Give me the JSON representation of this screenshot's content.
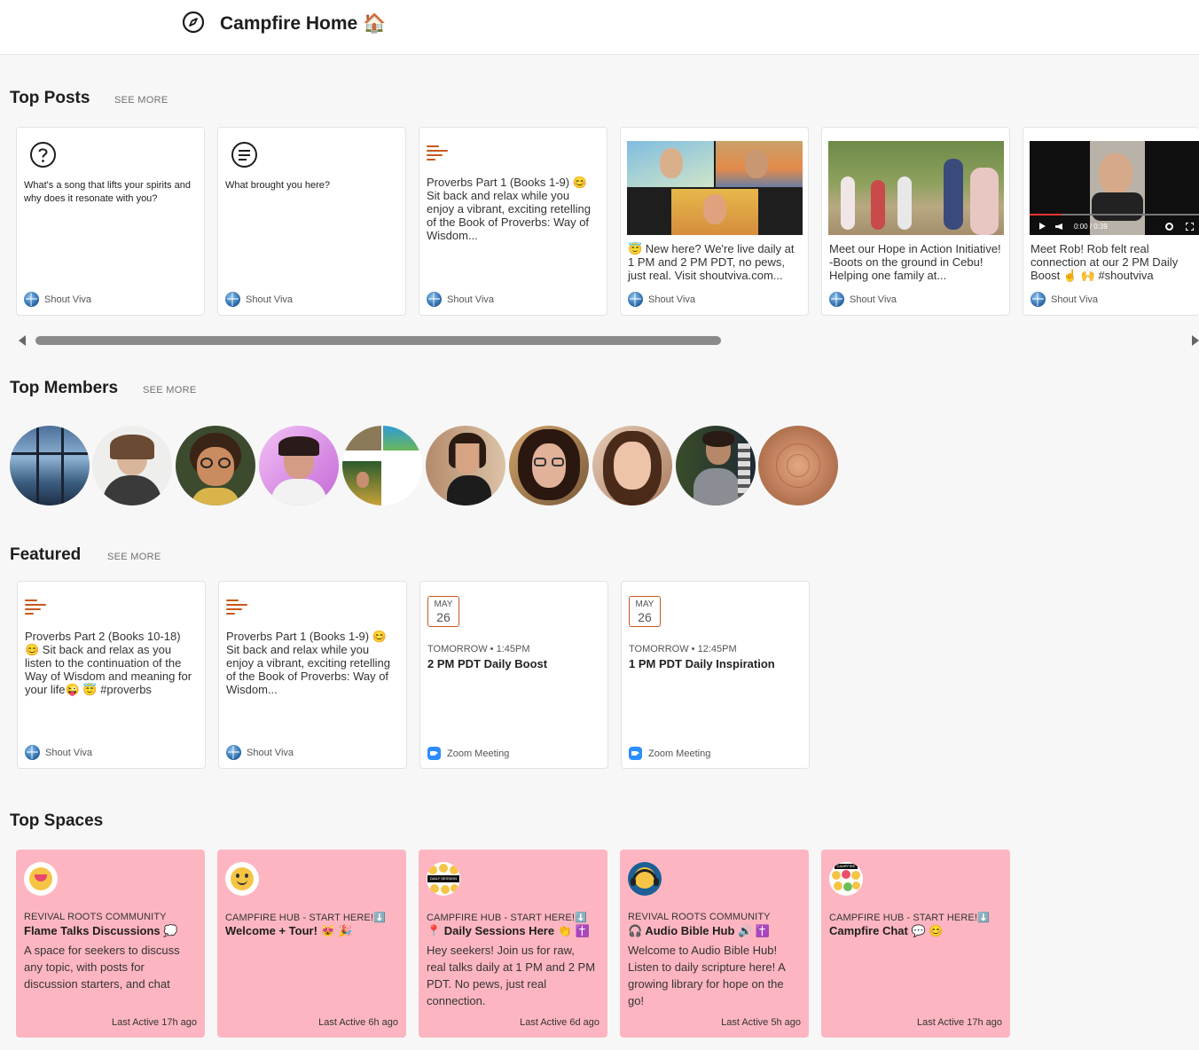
{
  "header": {
    "title": "Campfire Home 🏠",
    "icon": "compass-icon"
  },
  "sections": {
    "top_posts": "Top Posts",
    "top_members": "Top Members",
    "featured": "Featured",
    "top_spaces": "Top Spaces",
    "see_more": "SEE MORE"
  },
  "top_posts": [
    {
      "type": "question",
      "icon": "question-icon",
      "text": "What's a song that lifts your spirits and why does it resonate with you?",
      "author": "Shout Viva"
    },
    {
      "type": "question",
      "icon": "speech-icon",
      "text": "What brought you here?",
      "author": "Shout Viva"
    },
    {
      "type": "article",
      "icon": "text-lines-icon",
      "text": "Proverbs Part 1 (Books 1-9) 😊 Sit back and relax while you enjoy a vibrant, exciting retelling of the Book of Proverbs: Way of Wisdom...",
      "author": "Shout Viva"
    },
    {
      "type": "image",
      "text": "😇 New here? We're live daily at 1 PM and 2 PM PDT, no pews, just real. Visit shoutviva.com...",
      "author": "Shout Viva"
    },
    {
      "type": "image",
      "text": "Meet our Hope in Action Initiative! -Boots on the ground in Cebu! Helping one family at...",
      "author": "Shout Viva"
    },
    {
      "type": "video",
      "video_time": "0:00 / 0:39",
      "text": "Meet Rob! Rob felt real connection at our 2 PM Daily Boost ☝️ 🙌 #shoutviva",
      "author": "Shout Viva"
    }
  ],
  "featured": [
    {
      "type": "article",
      "text": "Proverbs Part 2 (Books 10-18) 😊 Sit back and relax as you listen to the continuation of the Way of Wisdom and meaning for your life😜 😇 #proverbs",
      "author": "Shout Viva"
    },
    {
      "type": "article",
      "text": "Proverbs Part 1 (Books 1-9) 😊 Sit back and relax while you enjoy a vibrant, exciting retelling of the Book of Proverbs: Way of Wisdom...",
      "author": "Shout Viva"
    },
    {
      "type": "event",
      "month": "MAY",
      "day": "26",
      "when": "TOMORROW • 1:45PM",
      "title": "2 PM PDT Daily Boost",
      "source": "Zoom Meeting"
    },
    {
      "type": "event",
      "month": "MAY",
      "day": "26",
      "when": "TOMORROW • 12:45PM",
      "title": "1 PM PDT Daily Inspiration",
      "source": "Zoom Meeting"
    }
  ],
  "top_spaces": [
    {
      "category": "REVIVAL ROOTS COMMUNITY",
      "name": "Flame Talks Discussions 💭",
      "description": "A space for seekers to discuss any topic, with posts for discussion starters, and chat",
      "last_active": "Last Active 17h ago"
    },
    {
      "category": "CAMPFIRE HUB - START HERE!⬇️",
      "name": "Welcome + Tour! 😻 🎉",
      "description": "",
      "last_active": "Last Active 6h ago"
    },
    {
      "category": "CAMPFIRE HUB - START HERE!⬇️",
      "name": "📍 Daily Sessions Here 👏 ✝️",
      "description": "Hey seekers! Join us for raw, real talks daily at 1 PM and 2 PM PDT. No pews, just real connection.",
      "last_active": "Last Active 6d ago"
    },
    {
      "category": "REVIVAL ROOTS COMMUNITY",
      "name": "🎧 Audio Bible Hub 🔊 ✝️",
      "description": "Welcome to Audio Bible Hub! Listen to daily scripture here! A growing library for hope on the go!",
      "last_active": "Last Active 5h ago"
    },
    {
      "category": "CAMPFIRE HUB - START HERE!⬇️",
      "name": "Campfire Chat 💬 😊",
      "description": "",
      "last_active": "Last Active 17h ago"
    }
  ],
  "space_logo_text": {
    "daily_session": "DAILY SESSION",
    "campfire": "CAMPFIRE"
  },
  "member_count": 10
}
